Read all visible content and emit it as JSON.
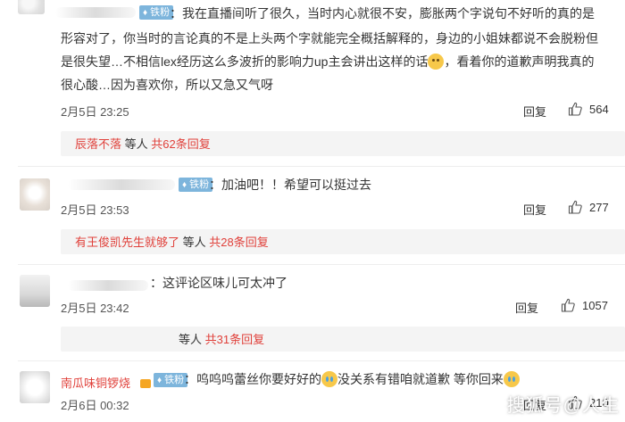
{
  "comments": [
    {
      "badge": "铁粉",
      "lines": [
        "：我在直播间听了很久，当时内心就很不安，膨胀两个字说句不好听的真的是",
        "形容对了，你当时的言论真的不是上头两个字就能完全概括解释的，身边的小姐妹都说不会脱粉但",
        "是很失望…不相信lex经历这么多波折的影响力up主会讲出这样的话",
        "，看着你的道歉声明我真的",
        "很心酸…因为喜欢你，所以又急又气呀"
      ],
      "time": "2月5日 23:25",
      "reply_label": "回复",
      "likes": "564",
      "sub_user": "辰落不落",
      "sub_mid": "等人",
      "sub_count": "共62条回复"
    },
    {
      "badge": "铁粉",
      "text": "：加油吧！！希望可以挺过去",
      "time": "2月5日 23:53",
      "reply_label": "回复",
      "likes": "277",
      "sub_user": "有王俊凯先生就够了",
      "sub_mid": "等人",
      "sub_count": "共28条回复"
    },
    {
      "text": "：这评论区味儿可太冲了",
      "time": "2月5日 23:42",
      "reply_label": "回复",
      "likes": "1057",
      "sub_mid": "等人",
      "sub_count": "共31条回复"
    },
    {
      "username": "南瓜味铜锣烧",
      "badge": "铁粉",
      "text_a": "：呜呜呜蕾丝你要好好的",
      "text_b": "没关系有错咱就道歉 等你回来",
      "time": "2月6日 00:32",
      "reply_label": "回复",
      "likes": "210"
    }
  ],
  "watermark": "搜狐号@人生",
  "colors": {
    "badge": "#7db5dc",
    "link_red": "#e0403a",
    "reply_bg": "#f4f4f4"
  },
  "icons": {
    "like": "thumbs-up-icon",
    "badge": "fan-badge-icon"
  }
}
